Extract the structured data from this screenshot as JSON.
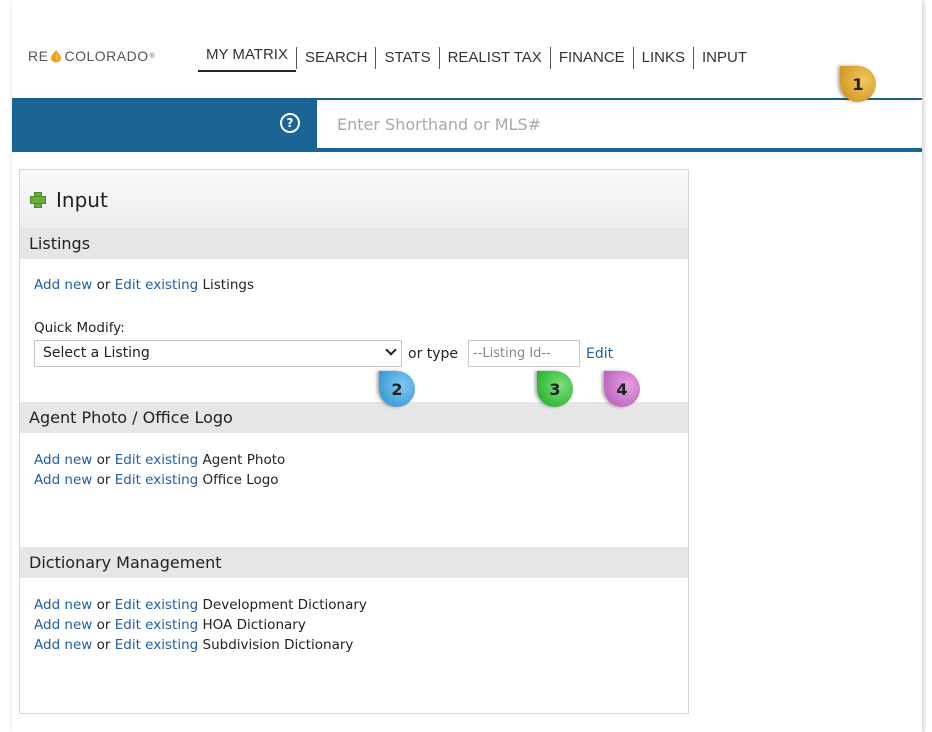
{
  "brand": {
    "logo_left": "RE",
    "logo_right": "COLORADO",
    "logo_mark": "®"
  },
  "nav": {
    "items": [
      {
        "label": "MY MATRIX",
        "active": true
      },
      {
        "label": "SEARCH"
      },
      {
        "label": "STATS"
      },
      {
        "label": "REALIST TAX"
      },
      {
        "label": "FINANCE"
      },
      {
        "label": "LINKS"
      },
      {
        "label": "INPUT"
      }
    ]
  },
  "search": {
    "help_icon": "question-circle-icon",
    "placeholder": "Enter Shorthand or MLS#",
    "value": ""
  },
  "panel": {
    "title": "Input",
    "icon": "plus-icon",
    "listings": {
      "header": "Listings",
      "line": {
        "add": "Add new",
        "or": "or",
        "edit": "Edit existing",
        "target": "Listings"
      },
      "quick_modify_label": "Quick Modify:",
      "select_value": "Select a Listing",
      "or_type": "or type",
      "listing_id_placeholder": "--Listing Id--",
      "edit_label": "Edit"
    },
    "agent": {
      "header": "Agent Photo / Office Logo",
      "lines": [
        {
          "add": "Add new",
          "or": "or",
          "edit": "Edit existing",
          "target": "Agent Photo"
        },
        {
          "add": "Add new",
          "or": "or",
          "edit": "Edit existing",
          "target": "Office Logo"
        }
      ]
    },
    "dictionary": {
      "header": "Dictionary Management",
      "lines": [
        {
          "add": "Add new",
          "or": "or",
          "edit": "Edit existing",
          "target": "Development Dictionary"
        },
        {
          "add": "Add new",
          "or": "or",
          "edit": "Edit existing",
          "target": "HOA Dictionary"
        },
        {
          "add": "Add new",
          "or": "or",
          "edit": "Edit existing",
          "target": "Subdivision Dictionary"
        }
      ]
    }
  },
  "callouts": [
    "1",
    "2",
    "3",
    "4"
  ],
  "colors": {
    "blue_bar": "#1a6596",
    "link": "#1f5fa6",
    "logo_drop": "#f0a21a",
    "plus": "#6dab3c"
  }
}
